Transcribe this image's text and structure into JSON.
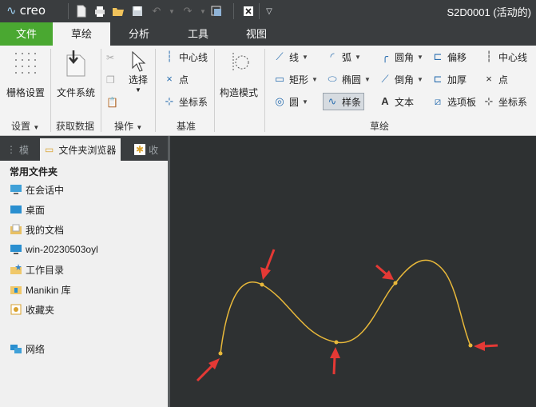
{
  "titlebar": {
    "logo_text": "creo",
    "window_title": "S2D0001 (活动的)"
  },
  "tabs": [
    {
      "label": "文件"
    },
    {
      "label": "草绘"
    },
    {
      "label": "分析"
    },
    {
      "label": "工具"
    },
    {
      "label": "视图"
    }
  ],
  "ribbon": {
    "groups": {
      "setup": "设置",
      "get_data": "获取数据",
      "operations": "操作",
      "datum": "基准",
      "sketch": "草绘"
    },
    "grid_settings": "栅格设置",
    "file_system": "文件系统",
    "select": "选择",
    "datum_centerline": "中心线",
    "datum_point": "点",
    "datum_csys": "坐标系",
    "construction_mode": "构造模式",
    "line": "线",
    "rectangle": "矩形",
    "circle": "圆",
    "arc": "弧",
    "ellipse": "椭圆",
    "spline": "样条",
    "fillet": "圆角",
    "chamfer": "倒角",
    "text": "文本",
    "offset": "偏移",
    "thicken": "加厚",
    "palette": "选项板",
    "centerline": "中心线",
    "point": "点",
    "csys": "坐标系"
  },
  "panel": {
    "tab_model": "模",
    "tab_folder": "文件夹浏览器",
    "tab_fav": "收",
    "section_title": "常用文件夹",
    "folders": [
      {
        "label": "在会话中"
      },
      {
        "label": "桌面"
      },
      {
        "label": "我的文档"
      },
      {
        "label": "win-20230503oyl"
      },
      {
        "label": "工作目录"
      },
      {
        "label": "Manikin 库"
      },
      {
        "label": "收藏夹"
      }
    ],
    "network": "网络"
  },
  "colors": {
    "spline": "#e8b83a",
    "arrow": "#e53935",
    "canvas_bg": "#2e3132",
    "file_tab": "#4aa831"
  }
}
